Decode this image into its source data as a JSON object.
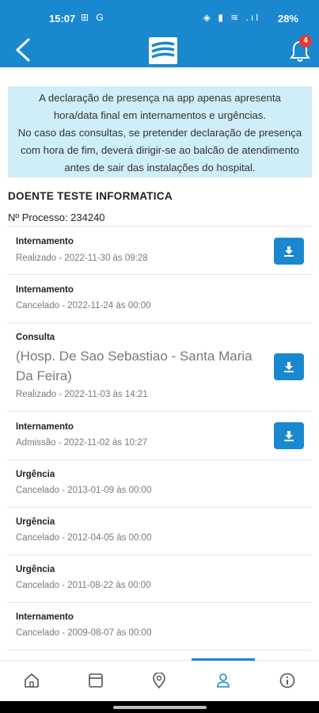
{
  "status_bar": {
    "time": "15:07",
    "left_icons": "⊞ G",
    "right_icons": "◈ ▮ ≋ .ıl",
    "battery": "28%"
  },
  "app_bar": {
    "notification_count": "4"
  },
  "notice": {
    "lines": [
      "A declaração de presença na app apenas apresenta",
      "hora/data final em internamentos e urgências.",
      "No caso das consultas, se pretender declaração de presença",
      "com hora de fim, deverá dirigir-se ao balcão de atendimento",
      "antes de sair das instalações do hospital."
    ]
  },
  "patient": {
    "name": "DOENTE TESTE INFORMATICA",
    "processo": "Nº Processo: 234240"
  },
  "records": [
    {
      "type": "Internamento",
      "location": "",
      "status": "Realizado - 2022-11-30 às 09:28",
      "download": true
    },
    {
      "type": "Internamento",
      "location": "",
      "status": "Cancelado - 2022-11-24 às 00:00",
      "download": false
    },
    {
      "type": "Consulta",
      "location": "(Hosp. De Sao Sebastiao - Santa Maria Da Feira)",
      "status": "Realizado - 2022-11-03 às 14:21",
      "download": true
    },
    {
      "type": "Internamento",
      "location": "",
      "status": "Admissão - 2022-11-02 às 10:27",
      "download": true
    },
    {
      "type": "Urgência",
      "location": "",
      "status": "Cancelado - 2013-01-09 às 00:00",
      "download": false
    },
    {
      "type": "Urgência",
      "location": "",
      "status": "Cancelado - 2012-04-05 às 00:00",
      "download": false
    },
    {
      "type": "Urgência",
      "location": "",
      "status": "Cancelado - 2011-08-22 às 00:00",
      "download": false
    },
    {
      "type": "Internamento",
      "location": "",
      "status": "Cancelado - 2009-08-07 às 00:00",
      "download": false
    }
  ],
  "bottom_nav": {
    "items": [
      "home-icon",
      "card-icon",
      "location-pin-icon",
      "profile-icon",
      "info-icon"
    ],
    "active": "profile-icon"
  },
  "colors": {
    "primary": "#1a88cf",
    "notice_bg": "#cfeef7",
    "badge": "#e53935"
  }
}
